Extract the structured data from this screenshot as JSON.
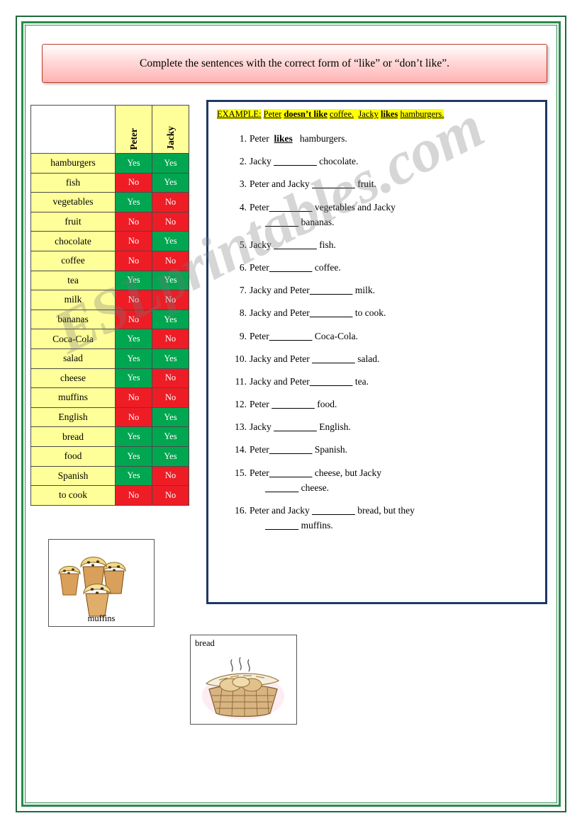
{
  "title": {
    "text": "Complete the sentences with the correct form of  “like” or “don’t like”."
  },
  "table": {
    "columns": [
      "",
      "Peter",
      "Jacky"
    ],
    "rows": [
      {
        "item": "hamburgers",
        "peter": "Yes",
        "jacky": "Yes"
      },
      {
        "item": "fish",
        "peter": "No",
        "jacky": "Yes"
      },
      {
        "item": "vegetables",
        "peter": "Yes",
        "jacky": "No"
      },
      {
        "item": "fruit",
        "peter": "No",
        "jacky": "No"
      },
      {
        "item": "chocolate",
        "peter": "No",
        "jacky": "Yes"
      },
      {
        "item": "coffee",
        "peter": "No",
        "jacky": "No"
      },
      {
        "item": "tea",
        "peter": "Yes",
        "jacky": "Yes"
      },
      {
        "item": "milk",
        "peter": "No",
        "jacky": "No"
      },
      {
        "item": "bananas",
        "peter": "No",
        "jacky": "Yes"
      },
      {
        "item": "Coca-Cola",
        "peter": "Yes",
        "jacky": "No"
      },
      {
        "item": "salad",
        "peter": "Yes",
        "jacky": "Yes"
      },
      {
        "item": "cheese",
        "peter": "Yes",
        "jacky": "No"
      },
      {
        "item": "muffins",
        "peter": "No",
        "jacky": "No"
      },
      {
        "item": "English",
        "peter": "No",
        "jacky": "Yes"
      },
      {
        "item": "bread",
        "peter": "Yes",
        "jacky": "Yes"
      },
      {
        "item": "food",
        "peter": "Yes",
        "jacky": "Yes"
      },
      {
        "item": "Spanish",
        "peter": "Yes",
        "jacky": "No"
      },
      {
        "item": "to cook",
        "peter": "No",
        "jacky": "No"
      }
    ]
  },
  "exercise": {
    "example": {
      "label": "EXAMPLE:",
      "part1_subject": "Peter",
      "part1_verb": "doesn’t like",
      "part1_object": "coffee.",
      "part2_subject": "Jacky",
      "part2_verb": "likes",
      "part2_object": "hamburgers."
    },
    "questions": [
      {
        "pre": "Peter",
        "answer": "likes",
        "post": " hamburgers.",
        "second": ""
      },
      {
        "pre": "Jacky ",
        "answer": "",
        "post": " chocolate.",
        "second": ""
      },
      {
        "pre": "Peter and Jacky ",
        "answer": "",
        "post": " fruit.",
        "second": ""
      },
      {
        "pre": "Peter",
        "answer": "",
        "post": " vegetables and Jacky",
        "second": " bananas."
      },
      {
        "pre": "Jacky ",
        "answer": "",
        "post": " fish.",
        "second": ""
      },
      {
        "pre": "Peter",
        "answer": "",
        "post": " coffee.",
        "second": ""
      },
      {
        "pre": "Jacky and Peter",
        "answer": "",
        "post": " milk.",
        "second": ""
      },
      {
        "pre": "Jacky and Peter",
        "answer": "",
        "post": " to cook.",
        "second": ""
      },
      {
        "pre": "Peter",
        "answer": "",
        "post": " Coca-Cola.",
        "second": ""
      },
      {
        "pre": "Jacky and Peter ",
        "answer": "",
        "post": " salad.",
        "second": ""
      },
      {
        "pre": "Jacky and Peter",
        "answer": "",
        "post": " tea.",
        "second": ""
      },
      {
        "pre": "Peter ",
        "answer": "",
        "post": " food.",
        "second": ""
      },
      {
        "pre": "Jacky ",
        "answer": "",
        "post": " English.",
        "second": ""
      },
      {
        "pre": "Peter",
        "answer": "",
        "post": " Spanish.",
        "second": ""
      },
      {
        "pre": "Peter",
        "answer": "",
        "post": " cheese, but Jacky",
        "second": " cheese."
      },
      {
        "pre": "Peter and Jacky ",
        "answer": "",
        "post": " bread, but they",
        "second": " muffins."
      }
    ]
  },
  "images": {
    "muffins": {
      "caption": "muffins"
    },
    "bread": {
      "caption": "bread"
    }
  },
  "watermark": {
    "text": "ESLprintables.com"
  },
  "colors": {
    "yes": "#00a650",
    "no": "#ee1c25",
    "item_bg": "#ffff99",
    "box_border": "#1f3864",
    "page_border": "#2a8a4c",
    "title_border": "#c0392b"
  }
}
